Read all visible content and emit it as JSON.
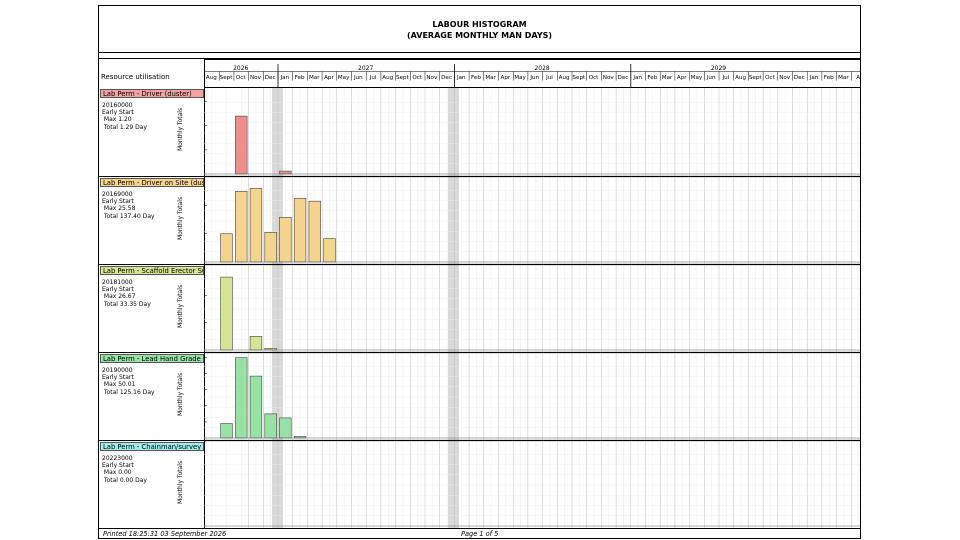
{
  "title": {
    "line1": "LABOUR HISTOGRAM",
    "line2": "(AVERAGE MONTHLY MAN DAYS)"
  },
  "resource_utilisation_label": "Resource utilisation",
  "footer": {
    "printed": "Printed 18:25:31 03 September 2026",
    "page": "Page 1 of 5"
  },
  "chart_data": {
    "type": "bar",
    "years": [
      "2026",
      "2027",
      "2028",
      "2029"
    ],
    "months": [
      "Aug",
      "Sept",
      "Oct",
      "Nov",
      "Dec",
      "Jan",
      "Feb",
      "Mar",
      "Apr",
      "May",
      "Jun",
      "Jul",
      "Aug",
      "Sept",
      "Oct",
      "Nov",
      "Dec",
      "Jan",
      "Feb",
      "Mar",
      "Apr",
      "May",
      "Jun",
      "Jul",
      "Aug",
      "Sept",
      "Oct",
      "Nov",
      "Dec",
      "Jan",
      "Feb",
      "Mar",
      "Apr",
      "May",
      "Jun",
      "Jul",
      "Aug",
      "Sept",
      "Oct",
      "Nov",
      "Dec",
      "Jan",
      "Feb",
      "Mar",
      "A"
    ],
    "ylabel": "Monthly Totals",
    "series": [
      {
        "name": "Lab Perm - Driver (duster)",
        "code": "20160000",
        "mode": "Early Start",
        "max": "Max 1.20",
        "total": "Total 1.29 Day",
        "color": "#ee8f8f",
        "label_color": "#f4a3a3",
        "ylim": [
          0,
          1.7
        ],
        "ticks": [
          0.5,
          1.0,
          1.5
        ],
        "tick_labels": [
          "0.50",
          "1.00",
          "1.50"
        ],
        "values": [
          0,
          0,
          1.2,
          0,
          0,
          0.06,
          0,
          0,
          0
        ]
      },
      {
        "name": "Lab Perm - Driver on Site (duster)",
        "code": "20169000",
        "mode": "Early Start",
        "max": "Max 25.58",
        "total": "Total 137.40 Day",
        "color": "#f5d48e",
        "label_color": "#f5d48e",
        "ylim": [
          0,
          29
        ],
        "ticks": [
          10,
          20
        ],
        "tick_labels": [
          "10",
          "20"
        ],
        "values": [
          0,
          10,
          25,
          26,
          10.5,
          15.8,
          22.5,
          21.5,
          8.3
        ]
      },
      {
        "name": "Lab Perm - Scaffold Erector Supervisor",
        "code": "20181000",
        "mode": "Early Start",
        "max": "Max 26.67",
        "total": "Total 33.35 Day",
        "color": "#d4e594",
        "label_color": "#d4e594",
        "ylim": [
          0,
          30
        ],
        "ticks": [
          10,
          20
        ],
        "tick_labels": [
          "10",
          "20"
        ],
        "values": [
          0,
          26.67,
          0,
          5,
          0.6,
          0,
          0,
          0,
          0
        ]
      },
      {
        "name": "Lab Perm - Lead Hand Grade Supervisor",
        "code": "20190000",
        "mode": "Early Start",
        "max": "Max 50.01",
        "total": "Total 125.16 Day",
        "color": "#98e2a6",
        "label_color": "#98e2a6",
        "ylim": [
          0,
          51
        ],
        "ticks": [
          10,
          20,
          30,
          40,
          50
        ],
        "tick_labels": [
          "10",
          "20",
          "30",
          "40",
          "50"
        ],
        "values": [
          0,
          9,
          50,
          38.5,
          15,
          12.5,
          1,
          0,
          0
        ]
      },
      {
        "name": "Lab Perm - Chainman/survey Assistant",
        "code": "20223000",
        "mode": "Early Start",
        "max": "Max 0.00",
        "total": "Total 0.00 Day",
        "color": "#a0ecec",
        "label_color": "#a0ecec",
        "ylim": [
          0,
          10
        ],
        "ticks": [],
        "tick_labels": [],
        "values": [
          0,
          0,
          0,
          0,
          0,
          0,
          0,
          0,
          0
        ]
      }
    ]
  }
}
